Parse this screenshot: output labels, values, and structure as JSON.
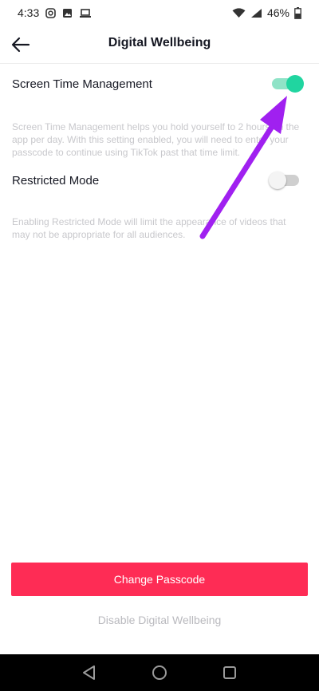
{
  "status_bar": {
    "time": "4:33",
    "battery": "46%",
    "left_icons": [
      "instagram-icon",
      "image-icon",
      "laptop-icon"
    ],
    "right_icons": [
      "wifi-icon",
      "signal-icon",
      "battery-icon"
    ]
  },
  "header": {
    "title": "Digital Wellbeing",
    "back_icon": "back-arrow-icon"
  },
  "settings": {
    "screen_time": {
      "label": "Screen Time Management",
      "enabled": true,
      "description": "Screen Time Management helps you hold yourself to 2 hours on the app per day. With this setting enabled, you will need to enter your passcode to continue using TikTok past that time limit."
    },
    "restricted_mode": {
      "label": "Restricted Mode",
      "enabled": false,
      "description": "Enabling Restricted Mode will limit the appearance of videos that may not be appropriate for all audiences."
    }
  },
  "actions": {
    "change_passcode": "Change Passcode",
    "disable": "Disable Digital Wellbeing"
  },
  "nav_bar": {
    "icons": [
      "back-triangle-icon",
      "home-circle-icon",
      "recents-square-icon"
    ]
  },
  "colors": {
    "accent": "#fe2c55",
    "toggle_on": "#20d5a0",
    "annotation_arrow": "#a020f0"
  }
}
